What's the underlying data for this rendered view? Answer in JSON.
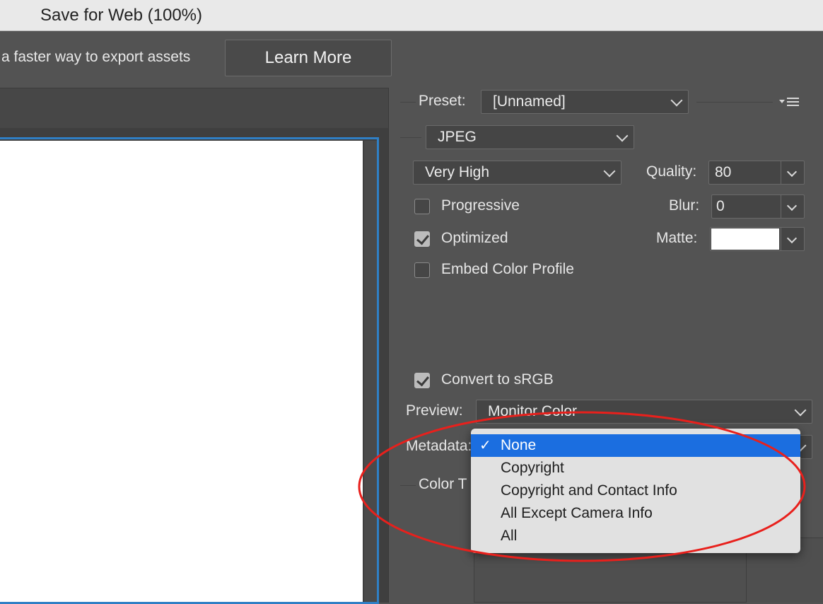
{
  "window": {
    "title": "Save for Web (100%)"
  },
  "banner": {
    "text": "a faster way to export assets",
    "learn_more": "Learn More"
  },
  "panel": {
    "preset": {
      "label": "Preset:",
      "value": "[Unnamed]"
    },
    "format": {
      "value": "JPEG"
    },
    "quality_preset": {
      "value": "Very High"
    },
    "quality": {
      "label": "Quality:",
      "value": "80"
    },
    "blur": {
      "label": "Blur:",
      "value": "0"
    },
    "matte": {
      "label": "Matte:",
      "color": "#ffffff"
    },
    "progressive": {
      "label": "Progressive",
      "checked": false
    },
    "optimized": {
      "label": "Optimized",
      "checked": true
    },
    "embed_profile": {
      "label": "Embed Color Profile",
      "checked": false
    },
    "convert_srgb": {
      "label": "Convert to sRGB",
      "checked": true
    },
    "preview": {
      "label": "Preview:",
      "value": "Monitor Color"
    },
    "metadata": {
      "label": "Metadata:"
    },
    "color_table": {
      "label": "Color T"
    }
  },
  "metadata_menu": {
    "selected": "None",
    "items": [
      "None",
      "Copyright",
      "Copyright and Contact Info",
      "All Except Camera Info",
      "All"
    ]
  },
  "annotation": {
    "color": "#e8201c",
    "shape": "ellipse"
  },
  "colors": {
    "accent": "#1b6ee0",
    "canvas_border": "#2f7fc5",
    "panel_bg": "#535353"
  }
}
